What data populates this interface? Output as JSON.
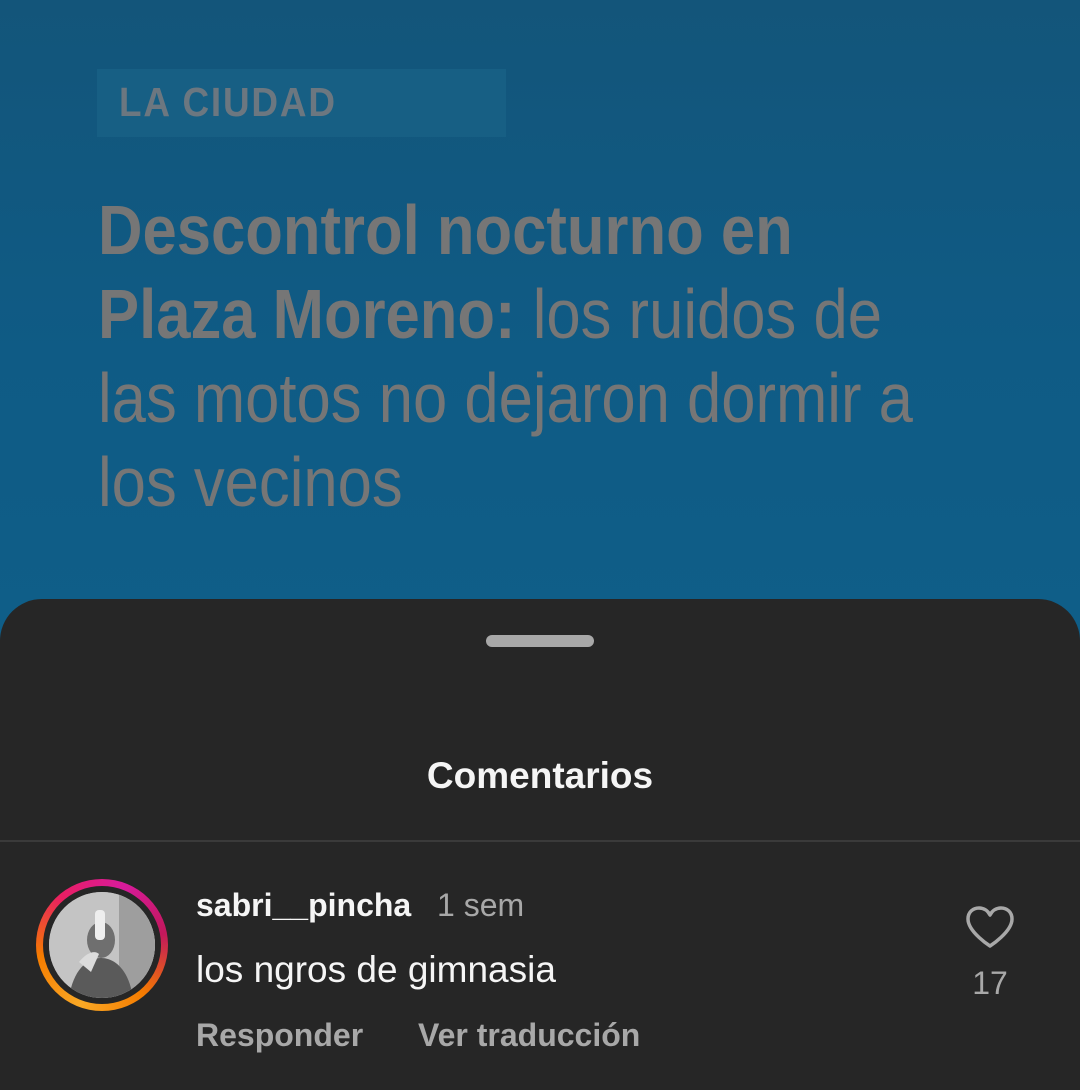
{
  "post": {
    "tag": "LA CIUDAD",
    "headline_bold": "Descontrol nocturno en Plaza Moreno:",
    "headline_regular": " los ruidos de las motos no dejaron dormir a los vecinos"
  },
  "sheet": {
    "title": "Comentarios"
  },
  "comment": {
    "username": "sabri__pincha",
    "time": "1 sem",
    "text": "los ngros de gimnasia",
    "reply_label": "Responder",
    "translate_label": "Ver traducción",
    "like_count": "17",
    "like_icon": "heart-outline-icon"
  },
  "colors": {
    "sheet_bg": "#262626",
    "text_primary": "#f5f5f5",
    "text_secondary": "#a8a8a8",
    "post_bg": "#0f5b85"
  }
}
